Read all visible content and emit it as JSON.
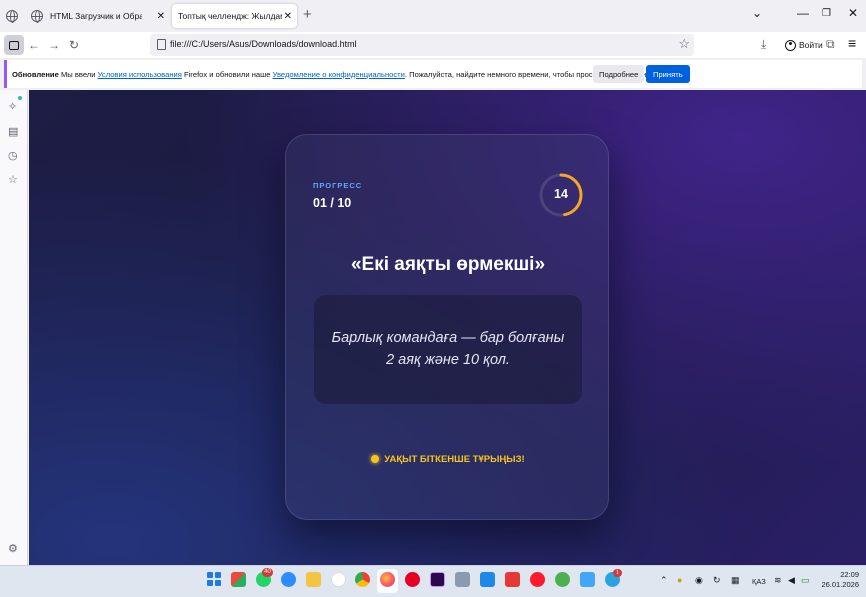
{
  "browser": {
    "tabs": [
      {
        "title": "HTML Загрузчик и Обработка",
        "active": false
      },
      {
        "title": "Топтық челлендж: Жылдамдық пе",
        "active": true
      }
    ],
    "address": "file:///C:/Users/Asus/Downloads/download.html",
    "signin_label": "Войти"
  },
  "notification": {
    "title": "Обновление",
    "text_1": " Мы ввели ",
    "link_1": "Условия использования",
    "text_2": " Firefox и обновили наше ",
    "link_2": "Уведомление о конфиденциальности",
    "text_3": ". Пожалуйста, найдите немного времени, чтобы просмотреть и принять.",
    "more_label": "Подробнее",
    "accept_label": "Принять"
  },
  "game": {
    "progress_label": "ПРОГРЕСС",
    "progress_value": "01 / 10",
    "timer_value": "14",
    "timer_fraction": 0.47,
    "title": "«Екі аяқты өрмекші»",
    "quote": "Барлық командаға — бар болғаны 2 аяқ және 10 қол.",
    "hint": "УАҚЫТ БІТКЕНШЕ ТҰРЫҢЫЗ!"
  },
  "taskbar": {
    "whatsapp_badge": "40",
    "telegram_badge": "1",
    "language": "ҚАЗ",
    "time": "22:09",
    "date": "26.01.2026"
  },
  "colors": {
    "accent_orange": "#f5a623",
    "progress_blue": "#5fa8ff",
    "hint_yellow": "#f5c518",
    "firefox_blue": "#0061e0"
  }
}
